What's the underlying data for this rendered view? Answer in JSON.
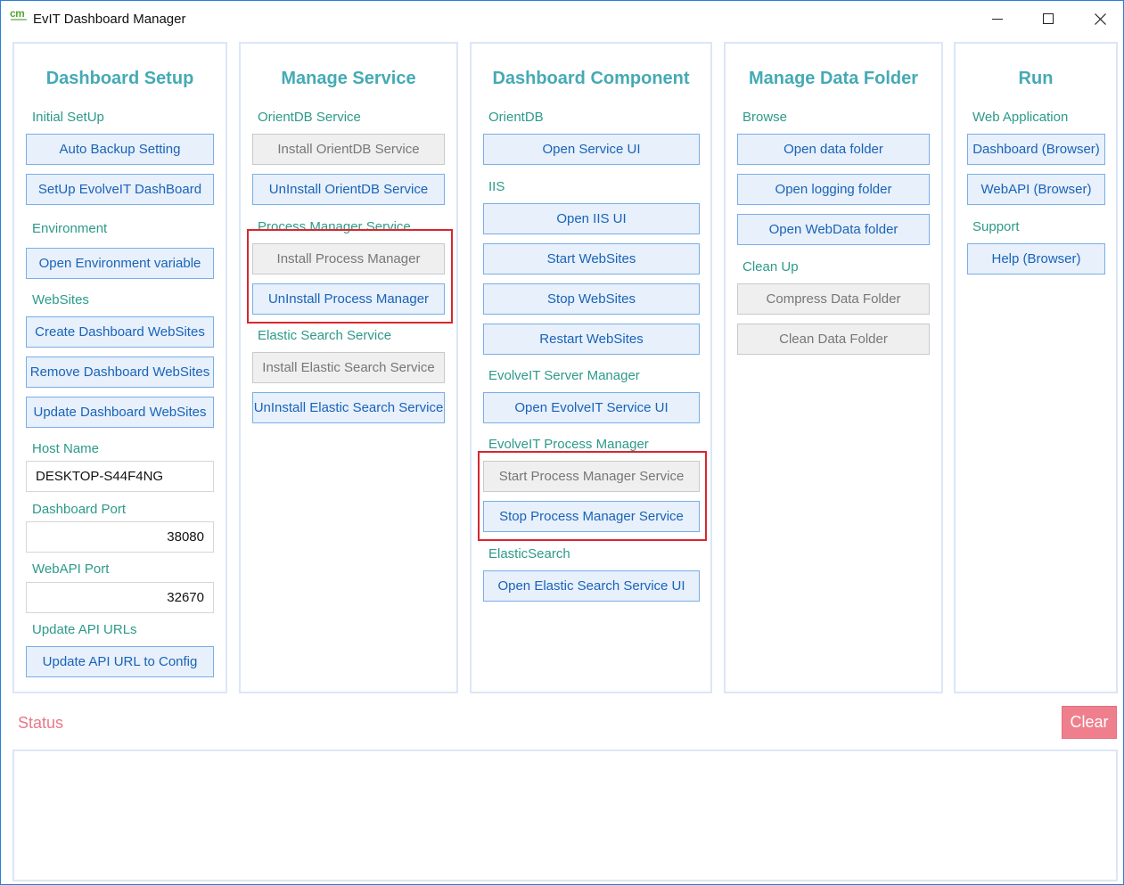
{
  "window": {
    "title": "EvIT Dashboard Manager",
    "logo_text": "cm"
  },
  "panels": {
    "setup": {
      "title": "Dashboard Setup",
      "initial_setup_label": "Initial SetUp",
      "auto_backup": "Auto Backup Setting",
      "setup_evolveit": "SetUp EvolveIT DashBoard",
      "environment_label": "Environment",
      "open_env": "Open Environment variable",
      "websites_label": "WebSites",
      "create_websites": "Create Dashboard WebSites",
      "remove_websites": "Remove Dashboard WebSites",
      "update_websites": "Update Dashboard WebSites",
      "host_name_label": "Host Name",
      "host_name_value": "DESKTOP-S44F4NG",
      "dashboard_port_label": "Dashboard Port",
      "dashboard_port_value": "38080",
      "webapi_port_label": "WebAPI Port",
      "webapi_port_value": "32670",
      "update_api_label": "Update API URLs",
      "update_api_button": "Update API URL to Config"
    },
    "service": {
      "title": "Manage Service",
      "orientdb_label": "OrientDB Service",
      "install_orientdb": "Install OrientDB Service",
      "uninstall_orientdb": "UnInstall OrientDB Service",
      "process_label": "Process Manager Service",
      "install_process": "Install Process Manager",
      "uninstall_process": "UnInstall Process Manager",
      "elastic_label": "Elastic Search Service",
      "install_elastic": "Install Elastic Search Service",
      "uninstall_elastic": "UnInstall Elastic Search Service"
    },
    "component": {
      "title": "Dashboard Component",
      "orientdb_label": "OrientDB",
      "open_service_ui": "Open Service UI",
      "iis_label": "IIS",
      "open_iis_ui": "Open IIS UI",
      "start_websites": "Start WebSites",
      "stop_websites": "Stop WebSites",
      "restart_websites": "Restart WebSites",
      "server_manager_label": "EvolveIT Server Manager",
      "open_evolveit_ui": "Open EvolveIT Service UI",
      "process_manager_label": "EvolveIT Process Manager",
      "start_process": "Start Process Manager Service",
      "stop_process": "Stop Process Manager Service",
      "elastic_label": "ElasticSearch",
      "open_elastic_ui": "Open Elastic Search Service UI"
    },
    "data_folder": {
      "title": "Manage Data Folder",
      "browse_label": "Browse",
      "open_data": "Open data folder",
      "open_logging": "Open logging folder",
      "open_webdata": "Open WebData folder",
      "cleanup_label": "Clean Up",
      "compress": "Compress Data Folder",
      "clean": "Clean Data Folder"
    },
    "run": {
      "title": "Run",
      "web_app_label": "Web Application",
      "dashboard_browser": "Dashboard (Browser)",
      "webapi_browser": "WebAPI (Browser)",
      "support_label": "Support",
      "help_browser": "Help (Browser)"
    }
  },
  "status": {
    "label": "Status",
    "clear": "Clear",
    "log": ""
  },
  "colors": {
    "accent_title": "#45aab5",
    "section_label": "#2d9a8a",
    "button_bg": "#e7f0fb",
    "button_border": "#79aee8",
    "button_text": "#1a63b8",
    "highlight": "#d8262f",
    "clear_button": "#ef7f8d",
    "status_label": "#e8788a"
  }
}
